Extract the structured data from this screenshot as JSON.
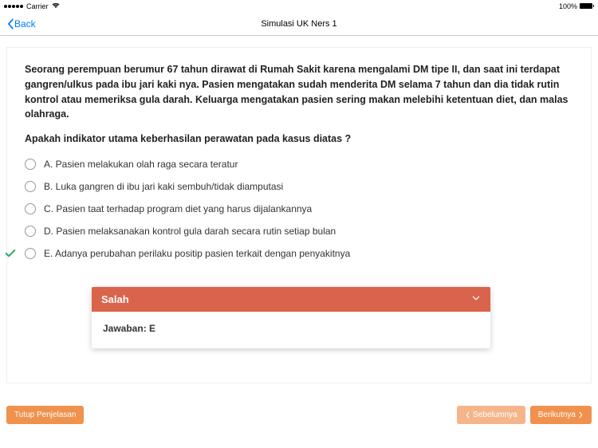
{
  "status": {
    "carrier": "Carrier",
    "battery_pct": "100%"
  },
  "nav": {
    "back": "Back",
    "title": "Simulasi UK Ners 1"
  },
  "question": {
    "text": "Seorang perempuan berumur 67 tahun dirawat di Rumah Sakit karena mengalami DM tipe II, dan saat ini terdapat gangren/ulkus pada ibu jari kaki nya. Pasien mengatakan sudah menderita DM selama 7 tahun dan dia tidak rutin kontrol atau memeriksa gula darah. Keluarga mengatakan pasien sering makan melebihi ketentuan diet, dan malas olahraga.",
    "prompt": "Apakah indikator utama keberhasilan perawatan pada kasus diatas ?"
  },
  "options": {
    "a": "A. Pasien melakukan olah raga secara teratur",
    "b": "B. Luka gangren di ibu jari kaki sembuh/tidak diamputasi",
    "c": "C. Pasien taat terhadap program diet yang harus dijalankannya",
    "d": "D. Pasien melaksanakan kontrol gula darah secara rutin setiap bulan",
    "e": "E. Adanya perubahan perilaku positip pasien terkait dengan penyakitnya"
  },
  "answer": {
    "status": "Salah",
    "body": "Jawaban: E"
  },
  "footer": {
    "close": "Tutup Penjelasan",
    "prev": "Sebelumnya",
    "next": "Berikutnya"
  }
}
